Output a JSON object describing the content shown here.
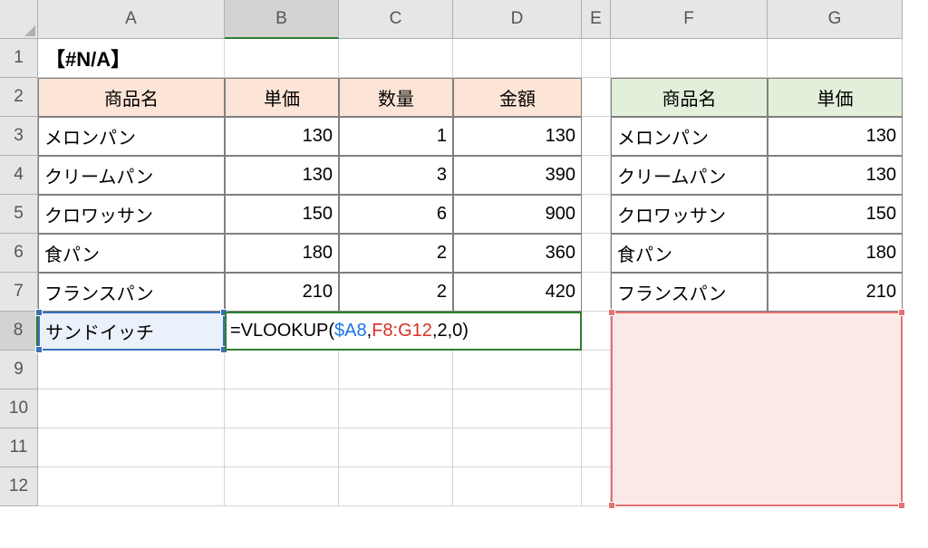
{
  "columns": [
    "A",
    "B",
    "C",
    "D",
    "E",
    "F",
    "G"
  ],
  "rows": [
    1,
    2,
    3,
    4,
    5,
    6,
    7,
    8,
    9,
    10,
    11,
    12
  ],
  "active_cell": "B8",
  "title": "【#N/A】",
  "table1": {
    "headers": [
      "商品名",
      "単価",
      "数量",
      "金額"
    ],
    "rows": [
      {
        "name": "メロンパン",
        "price": 130,
        "qty": 1,
        "amount": 130
      },
      {
        "name": "クリームパン",
        "price": 130,
        "qty": 3,
        "amount": 390
      },
      {
        "name": "クロワッサン",
        "price": 150,
        "qty": 6,
        "amount": 900
      },
      {
        "name": "食パン",
        "price": 180,
        "qty": 2,
        "amount": 360
      },
      {
        "name": "フランスパン",
        "price": 210,
        "qty": 2,
        "amount": 420
      }
    ],
    "lookup_name": "サンドイッチ"
  },
  "table2": {
    "headers": [
      "商品名",
      "単価"
    ],
    "rows": [
      {
        "name": "メロンパン",
        "price": 130
      },
      {
        "name": "クリームパン",
        "price": 130
      },
      {
        "name": "クロワッサン",
        "price": 150
      },
      {
        "name": "食パン",
        "price": 180
      },
      {
        "name": "フランスパン",
        "price": 210
      }
    ]
  },
  "formula": {
    "prefix": "=VLOOKUP(",
    "arg1": "$A8",
    "comma1": ",",
    "arg2": "F8:G12",
    "comma2": ",",
    "arg3": "2",
    "comma3": ",",
    "arg4": "0",
    "suffix": ")"
  },
  "reference_range": "F8:G12"
}
